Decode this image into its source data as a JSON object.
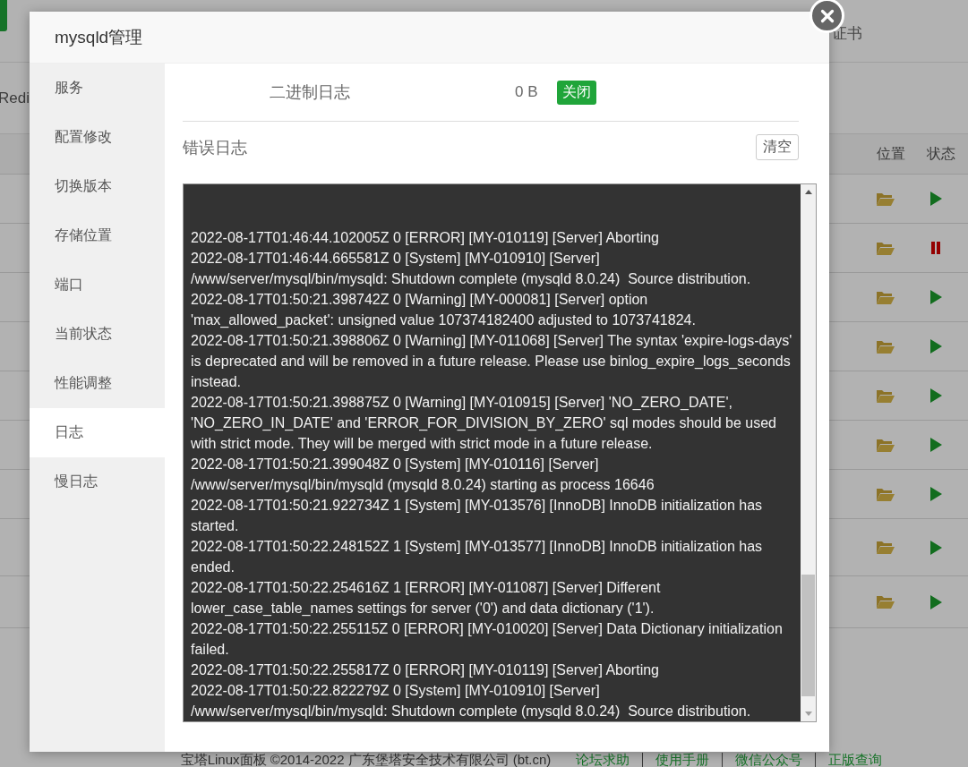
{
  "background": {
    "top_link": "证书",
    "tab": "Redi",
    "columns": [
      "位置",
      "状态"
    ],
    "rows": [
      {
        "running": true
      },
      {
        "running": false
      },
      {
        "running": true
      },
      {
        "running": true
      },
      {
        "running": true
      },
      {
        "running": true
      },
      {
        "running": true
      },
      {
        "running": true
      },
      {
        "running": true
      }
    ],
    "footer": {
      "copyright": "宝塔Linux面板 ©2014-2022 广东堡塔安全技术有限公司 (bt.cn)",
      "links": [
        "论坛求助",
        "使用手册",
        "微信公众号",
        "正版查询"
      ]
    }
  },
  "dialog": {
    "title": "mysqld管理",
    "sidebar": [
      {
        "label": "服务",
        "selected": false
      },
      {
        "label": "配置修改",
        "selected": false
      },
      {
        "label": "切换版本",
        "selected": false
      },
      {
        "label": "存储位置",
        "selected": false
      },
      {
        "label": "端口",
        "selected": false
      },
      {
        "label": "当前状态",
        "selected": false
      },
      {
        "label": "性能调整",
        "selected": false
      },
      {
        "label": "日志",
        "selected": true
      },
      {
        "label": "慢日志",
        "selected": false
      }
    ],
    "binary_log": {
      "label": "二进制日志",
      "size": "0 B",
      "button": "关闭"
    },
    "error_log": {
      "label": "错误日志",
      "button": "清空",
      "entries": [
        "2022-08-17T01:46:44.102005Z 0 [ERROR] [MY-010119] [Server] Aborting",
        "2022-08-17T01:46:44.665581Z 0 [System] [MY-010910] [Server] /www/server/mysql/bin/mysqld: Shutdown complete (mysqld 8.0.24)  Source distribution.",
        "2022-08-17T01:50:21.398742Z 0 [Warning] [MY-000081] [Server] option 'max_allowed_packet': unsigned value 107374182400 adjusted to 1073741824.",
        "2022-08-17T01:50:21.398806Z 0 [Warning] [MY-011068] [Server] The syntax 'expire-logs-days' is deprecated and will be removed in a future release. Please use binlog_expire_logs_seconds instead.",
        "2022-08-17T01:50:21.398875Z 0 [Warning] [MY-010915] [Server] 'NO_ZERO_DATE', 'NO_ZERO_IN_DATE' and 'ERROR_FOR_DIVISION_BY_ZERO' sql modes should be used with strict mode. They will be merged with strict mode in a future release.",
        "2022-08-17T01:50:21.399048Z 0 [System] [MY-010116] [Server] /www/server/mysql/bin/mysqld (mysqld 8.0.24) starting as process 16646",
        "2022-08-17T01:50:21.922734Z 1 [System] [MY-013576] [InnoDB] InnoDB initialization has started.",
        "2022-08-17T01:50:22.248152Z 1 [System] [MY-013577] [InnoDB] InnoDB initialization has ended.",
        "2022-08-17T01:50:22.254616Z 1 [ERROR] [MY-011087] [Server] Different lower_case_table_names settings for server ('0') and data dictionary ('1').",
        "2022-08-17T01:50:22.255115Z 0 [ERROR] [MY-010020] [Server] Data Dictionary initialization failed.",
        "2022-08-17T01:50:22.255817Z 0 [ERROR] [MY-010119] [Server] Aborting",
        "2022-08-17T01:50:22.822279Z 0 [System] [MY-010910] [Server] /www/server/mysql/bin/mysqld: Shutdown complete (mysqld 8.0.24)  Source distribution."
      ]
    }
  }
}
